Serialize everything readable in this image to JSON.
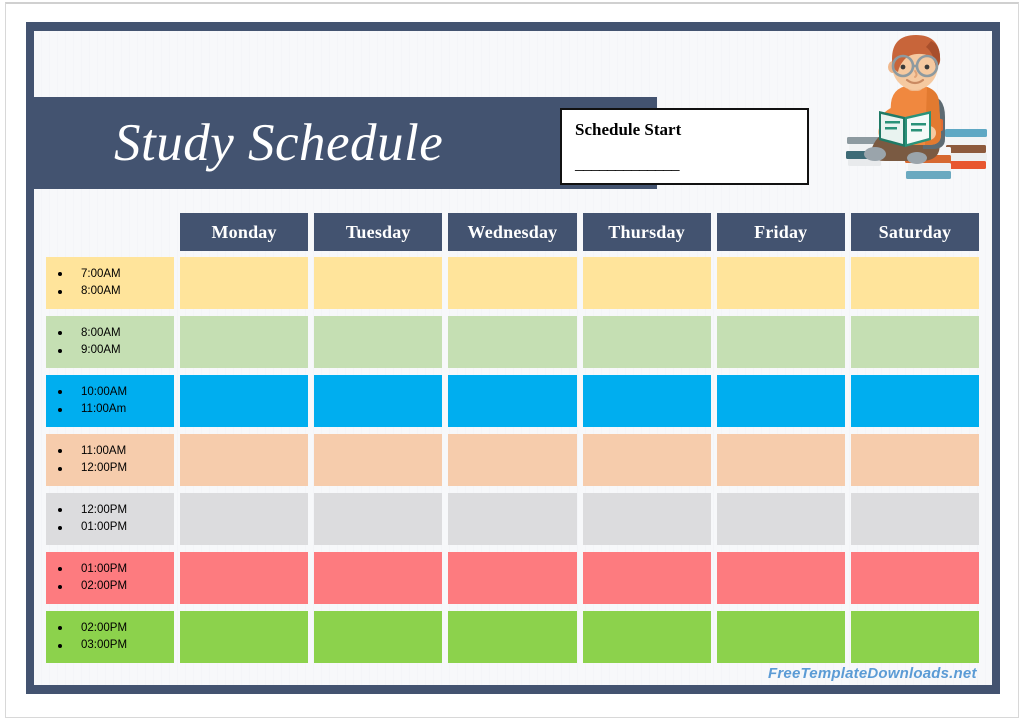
{
  "document": {
    "title": "Study Schedule",
    "watermark": "FreeTemplateDownloads.net"
  },
  "start_box": {
    "label": "Schedule Start",
    "blank": "_____________"
  },
  "illustration": {
    "name": "student-reading-book-illustration"
  },
  "colors": {
    "slate": "#435370",
    "panel": "#f7f8fa",
    "watermark": "#5b9bd5",
    "row_yellow": "#ffe49b",
    "row_green": "#c5dfb3",
    "row_blue": "#00aeef",
    "row_peach": "#f6ccac",
    "row_gray": "#dcdcde",
    "row_coral": "#fd7b7f",
    "row_lime": "#8cd24c"
  },
  "table": {
    "day_columns": [
      "Monday",
      "Tuesday",
      "Wednesday",
      "Thursday",
      "Friday",
      "Saturday"
    ],
    "rows": [
      {
        "start": "7:00AM",
        "end": "8:00AM",
        "color": "#ffe49b"
      },
      {
        "start": "8:00AM",
        "end": "9:00AM",
        "color": "#c5dfb3"
      },
      {
        "start": "10:00AM",
        "end": "11:00Am",
        "color": "#00aeef"
      },
      {
        "start": "11:00AM",
        "end": "12:00PM",
        "color": "#f6ccac"
      },
      {
        "start": "12:00PM",
        "end": "01:00PM",
        "color": "#dcdcde"
      },
      {
        "start": "01:00PM",
        "end": "02:00PM",
        "color": "#fd7b7f"
      },
      {
        "start": "02:00PM",
        "end": "03:00PM",
        "color": "#8cd24c"
      }
    ]
  }
}
